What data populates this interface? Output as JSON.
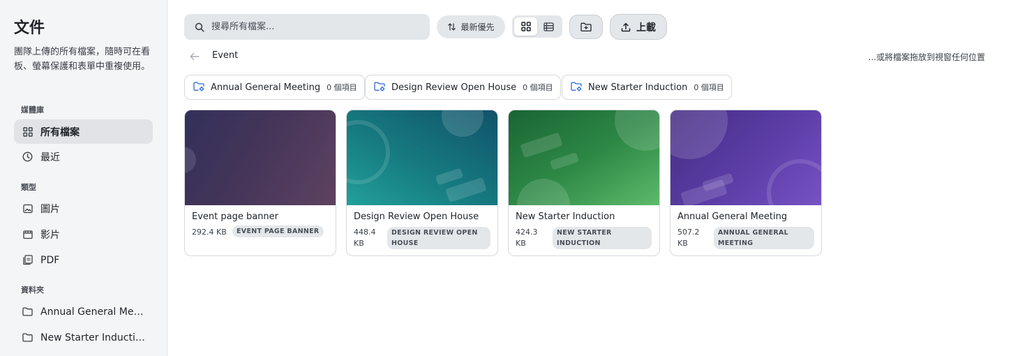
{
  "sidebar": {
    "title": "文件",
    "description": "團隊上傳的所有檔案，隨時可在看板、螢幕保護和表單中重複使用。",
    "sections": {
      "library": "媒體庫",
      "types": "類型",
      "folders": "資料夾"
    },
    "library_items": [
      {
        "label": "所有檔案",
        "icon": "grid-icon",
        "active": true
      },
      {
        "label": "最近",
        "icon": "clock-icon",
        "active": false
      }
    ],
    "type_items": [
      {
        "label": "圖片",
        "icon": "image-icon"
      },
      {
        "label": "影片",
        "icon": "film-icon"
      },
      {
        "label": "PDF",
        "icon": "pdf-icon"
      }
    ],
    "folder_items": [
      {
        "label": "Annual General Meeti...",
        "icon": "folder-icon"
      },
      {
        "label": "New Starter Induction",
        "icon": "folder-icon"
      }
    ]
  },
  "toolbar": {
    "search_placeholder": "搜尋所有檔案...",
    "sort_label": "最新優先",
    "view_mode": "grid",
    "upload_label": "上載"
  },
  "breadcrumb": {
    "current": "Event"
  },
  "drop_hint": "...或將檔案拖放到視窗任何位置",
  "folders": [
    {
      "name": "Annual General Meeting",
      "count": "0 個項目"
    },
    {
      "name": "Design Review Open House",
      "count": "0 個項目"
    },
    {
      "name": "New Starter Induction",
      "count": "0 個項目"
    }
  ],
  "files": [
    {
      "title": "Event page banner",
      "size_line1": "292.4 KB",
      "size_line2": "",
      "tag_line1": "EVENT PAGE BANNER",
      "tag_line2": "",
      "gradient": [
        "#33305a",
        "#5e4260"
      ]
    },
    {
      "title": "Design Review Open House",
      "size_line1": "448.4",
      "size_line2": "KB",
      "tag_line1": "DESIGN REVIEW OPEN",
      "tag_line2": "HOUSE",
      "gradient": [
        "#1d9896",
        "#125568"
      ]
    },
    {
      "title": "New Starter Induction",
      "size_line1": "424.3",
      "size_line2": "KB",
      "tag_line1": "NEW STARTER",
      "tag_line2": "INDUCTION",
      "gradient": [
        "#1e6b38",
        "#5bb868"
      ]
    },
    {
      "title": "Annual General Meeting",
      "size_line1": "507.2",
      "size_line2": "KB",
      "tag_line1": "ANNUAL GENERAL",
      "tag_line2": "MEETING",
      "gradient": [
        "#4a2f88",
        "#7450c0"
      ]
    }
  ]
}
